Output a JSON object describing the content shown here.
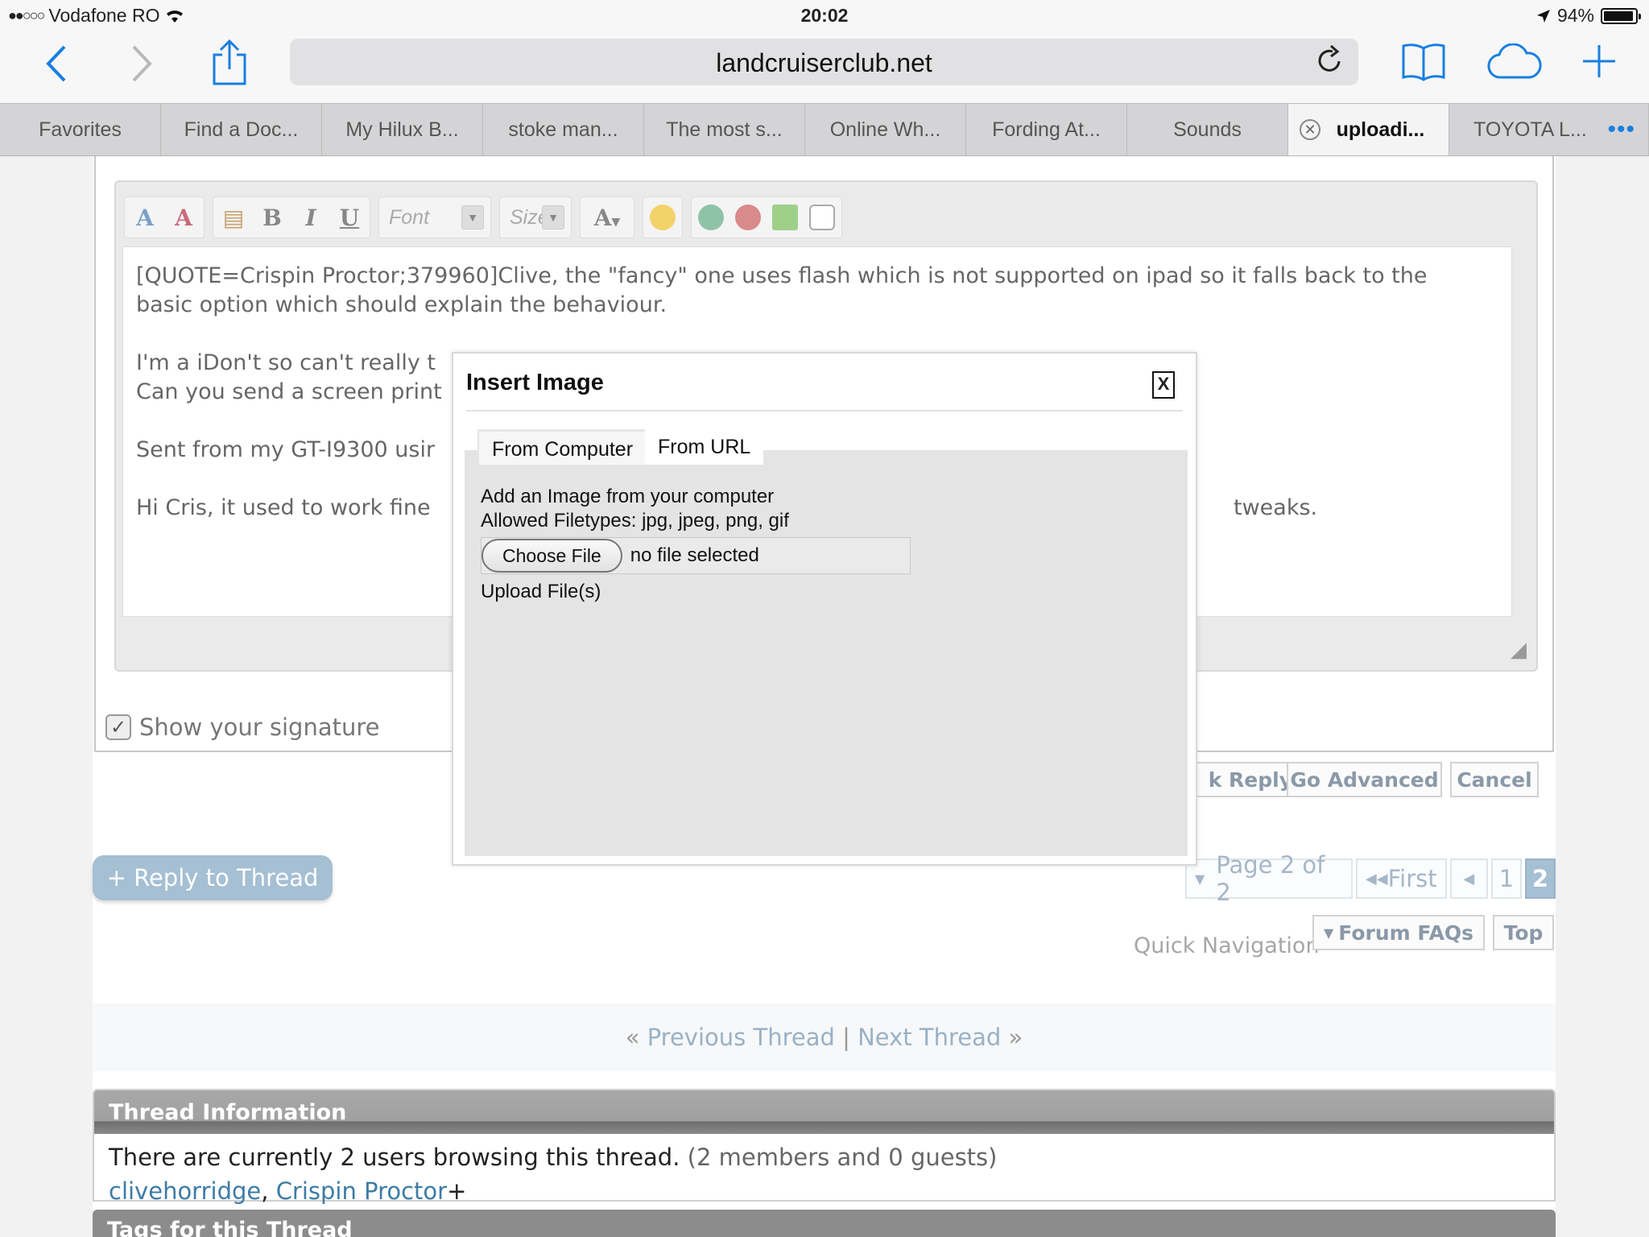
{
  "status_bar": {
    "carrier": "Vodafone RO",
    "time": "20:02",
    "battery": "94%",
    "battery_level": 0.94
  },
  "toolbar": {
    "url": "landcruiserclub.net"
  },
  "tabs": [
    {
      "label": "Favorites"
    },
    {
      "label": "Find a Doc..."
    },
    {
      "label": "My Hilux B..."
    },
    {
      "label": "stoke man..."
    },
    {
      "label": "The most s..."
    },
    {
      "label": "Online Wh..."
    },
    {
      "label": "Fording At..."
    },
    {
      "label": "Sounds"
    },
    {
      "label": "uploadi..."
    },
    {
      "label": "TOYOTA L..."
    }
  ],
  "editor": {
    "font_placeholder": "Font",
    "size_placeholder": "Size",
    "text_lines": [
      "[QUOTE=Crispin Proctor;379960]Clive, the \"fancy\" one uses flash which is not supported on ipad so it falls back to the",
      "basic option which should explain the behaviour.",
      "",
      "I'm a iDon't so can't really t",
      "Can you send a screen print",
      "",
      "Sent from my GT-I9300 usir",
      "",
      "Hi Cris, it used to work fine"
    ],
    "overflow_text": "tweaks."
  },
  "signature": {
    "label": "Show your signature",
    "checked": true
  },
  "buttons": {
    "quick_reply": "k Reply",
    "go_advanced": "Go Advanced",
    "cancel": "Cancel",
    "reply_to_thread": "+ Reply to Thread"
  },
  "pagination": {
    "page_label": "Page 2 of 2",
    "first": "First",
    "pages": [
      "1",
      "2"
    ],
    "current": "2"
  },
  "quick_nav": {
    "label": "Quick Navigation",
    "forum_faqs": "Forum FAQs",
    "top": "Top"
  },
  "thread_nav": {
    "prev": "Previous Thread",
    "next": "Next Thread",
    "left_quote": "«",
    "right_quote": "»",
    "separator": "|"
  },
  "thread_info": {
    "header": "Thread Information",
    "summary": "There are currently 2 users browsing this thread.",
    "detail": "(2 members and 0 guests)",
    "users": [
      "clivehorridge",
      "Crispin Proctor"
    ],
    "user_suffix": "+"
  },
  "tags": {
    "header": "Tags for this Thread"
  },
  "modal": {
    "title": "Insert Image",
    "close": "X",
    "tab_computer": "From Computer",
    "tab_url": "From URL",
    "line1": "Add an Image from your computer",
    "line2": "Allowed Filetypes: jpg, jpeg, png, gif",
    "choose_file": "Choose File",
    "no_file": "no file selected",
    "upload": "Upload File(s)"
  }
}
